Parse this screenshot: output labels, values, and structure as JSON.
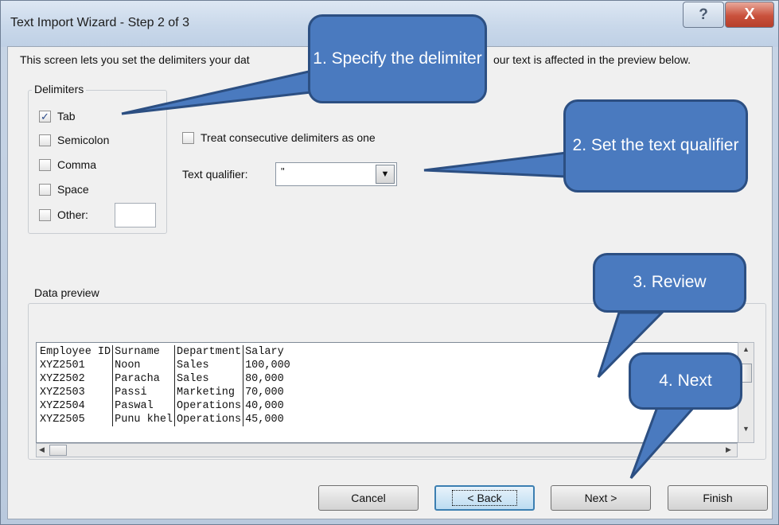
{
  "window": {
    "title": "Text Import Wizard - Step 2 of 3",
    "help_label": "?",
    "close_label": "X"
  },
  "intro": {
    "text_visible_left": "This screen lets you set the delimiters your dat",
    "text_visible_right": "our text is affected in the preview below."
  },
  "delimiters": {
    "legend": "Delimiters",
    "options": [
      {
        "label": "Tab",
        "checked": true
      },
      {
        "label": "Semicolon",
        "checked": false
      },
      {
        "label": "Comma",
        "checked": false
      },
      {
        "label": "Space",
        "checked": false
      },
      {
        "label": "Other:",
        "checked": false
      }
    ],
    "other_value": ""
  },
  "consecutive": {
    "label": "Treat consecutive delimiters as one",
    "checked": false
  },
  "text_qualifier": {
    "label": "Text qualifier:",
    "value": "\""
  },
  "preview": {
    "legend": "Data preview",
    "rows": [
      [
        "Employee ID",
        "Surname",
        "Department",
        "Salary"
      ],
      [
        "XYZ2501",
        "Noon",
        "Sales",
        "100,000"
      ],
      [
        "XYZ2502",
        "Paracha",
        "Sales",
        "80,000"
      ],
      [
        "XYZ2503",
        "Passi",
        "Marketing",
        "70,000"
      ],
      [
        "XYZ2504",
        "Paswal",
        "Operations",
        "40,000"
      ],
      [
        "XYZ2505",
        "Punu khel",
        "Operations",
        "45,000"
      ]
    ]
  },
  "buttons": {
    "cancel": "Cancel",
    "back": "< Back",
    "next": "Next >",
    "finish": "Finish"
  },
  "callouts": {
    "c1": "1. Specify the delimiter",
    "c2": "2. Set the text qualifier",
    "c3": "3. Review",
    "c4": "4. Next"
  },
  "colors": {
    "callout_fill": "#4a7abf",
    "callout_border": "#2c4f82",
    "close_button": "#c9513c"
  }
}
